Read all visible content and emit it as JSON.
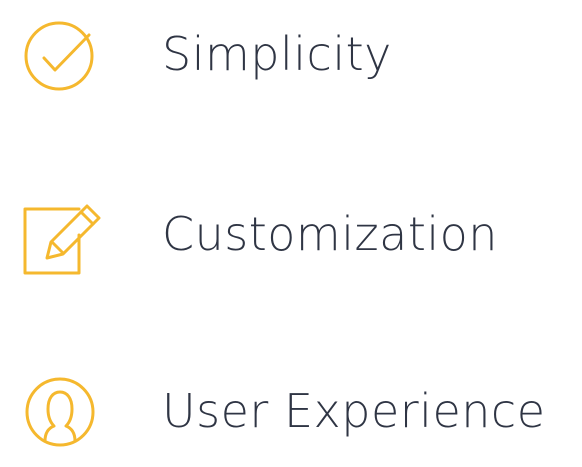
{
  "accent_color": "#f5b82e",
  "text_color": "#2f3544",
  "features": [
    {
      "icon": "check-circle-icon",
      "label": "Simplicity"
    },
    {
      "icon": "pencil-square-icon",
      "label": "Customization"
    },
    {
      "icon": "user-circle-icon",
      "label": "User Experience"
    }
  ]
}
